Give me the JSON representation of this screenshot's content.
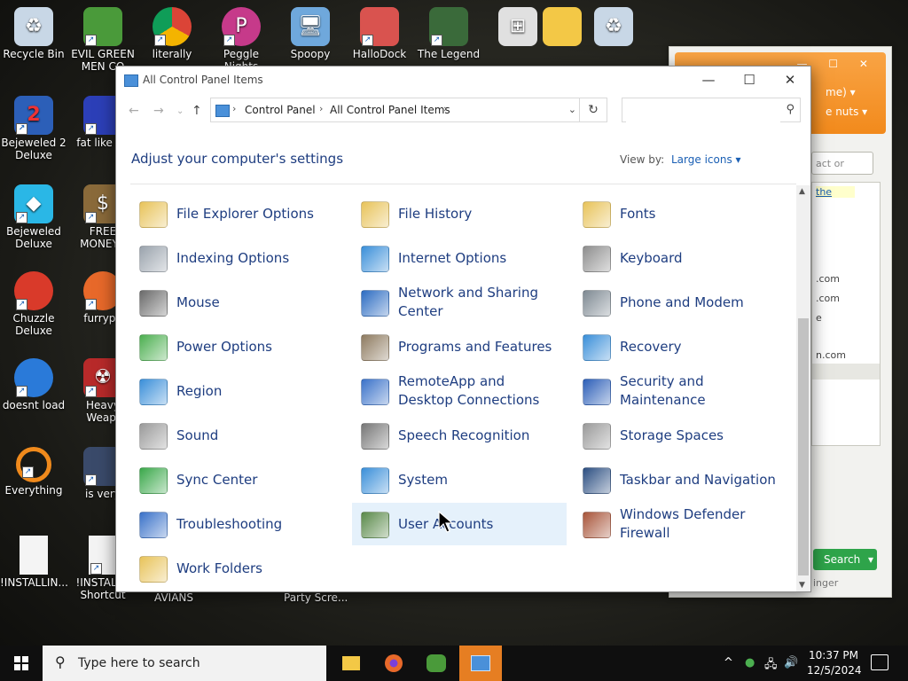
{
  "desktop": {
    "icons": [
      {
        "label": "Recycle Bin",
        "x": 0
      },
      {
        "label": "EVIL GREEN MEN CO"
      },
      {
        "label": "literally"
      },
      {
        "label": "Peggle Nights"
      },
      {
        "label": "Spoopy"
      },
      {
        "label": "HalloDock"
      },
      {
        "label": "The Legend"
      },
      {
        "label": "Bejeweled 2 Deluxe"
      },
      {
        "label": "fat like da"
      },
      {
        "label": "Bejeweled Deluxe"
      },
      {
        "label": "FREE MONEY.c"
      },
      {
        "label": "Chuzzle Deluxe"
      },
      {
        "label": "furrypo"
      },
      {
        "label": "doesnt load"
      },
      {
        "label": "Heavy Weap."
      },
      {
        "label": "Everything"
      },
      {
        "label": "is very"
      },
      {
        "label": "!INSTALLIN..."
      },
      {
        "label": "!INSTALL - Shortcut"
      },
      {
        "label": "AVIANS"
      },
      {
        "label": "Party Scre..."
      }
    ]
  },
  "bg_window": {
    "line1": "me) ▾",
    "line2": "e nuts ▾",
    "input_placeholder": "act or numbe",
    "link": "the",
    "rows": [
      ".com",
      ".com",
      "e",
      "n.com"
    ],
    "search_btn": "Search",
    "footer": "inger"
  },
  "window": {
    "title": "All Control Panel Items",
    "minimize": "—",
    "maximize": "☐",
    "close": "✕",
    "breadcrumb": [
      "Control Panel",
      "All Control Panel Items"
    ],
    "search_placeholder": "",
    "heading": "Adjust your computer's settings",
    "view_by_label": "View by:",
    "view_by_value": "Large icons ▾"
  },
  "items": [
    {
      "label": "File Explorer Options",
      "icon": "folder-options-icon",
      "color": "#e8c35a"
    },
    {
      "label": "File History",
      "icon": "file-history-icon",
      "color": "#e8c35a"
    },
    {
      "label": "Fonts",
      "icon": "fonts-icon",
      "color": "#e8c35a"
    },
    {
      "label": "Indexing Options",
      "icon": "indexing-icon",
      "color": "#9aa3ad"
    },
    {
      "label": "Internet Options",
      "icon": "internet-options-icon",
      "color": "#3a8fd9"
    },
    {
      "label": "Keyboard",
      "icon": "keyboard-icon",
      "color": "#8e8e8e"
    },
    {
      "label": "Mouse",
      "icon": "mouse-icon",
      "color": "#6a6a6a"
    },
    {
      "label": "Network and Sharing Center",
      "icon": "network-icon",
      "color": "#2c6cc2"
    },
    {
      "label": "Phone and Modem",
      "icon": "phone-modem-icon",
      "color": "#7f8a93"
    },
    {
      "label": "Power Options",
      "icon": "power-options-icon",
      "color": "#4caf50"
    },
    {
      "label": "Programs and Features",
      "icon": "programs-icon",
      "color": "#8e7b60"
    },
    {
      "label": "Recovery",
      "icon": "recovery-icon",
      "color": "#3a8fd9"
    },
    {
      "label": "Region",
      "icon": "region-icon",
      "color": "#3a8fd9"
    },
    {
      "label": "RemoteApp and Desktop Connections",
      "icon": "remoteapp-icon",
      "color": "#3a72c9"
    },
    {
      "label": "Security and Maintenance",
      "icon": "security-flag-icon",
      "color": "#2c5fb8"
    },
    {
      "label": "Sound",
      "icon": "sound-icon",
      "color": "#9a9a9a"
    },
    {
      "label": "Speech Recognition",
      "icon": "microphone-icon",
      "color": "#777777"
    },
    {
      "label": "Storage Spaces",
      "icon": "storage-icon",
      "color": "#9a9a9a"
    },
    {
      "label": "Sync Center",
      "icon": "sync-icon",
      "color": "#3aa84a"
    },
    {
      "label": "System",
      "icon": "system-icon",
      "color": "#3a8fd9"
    },
    {
      "label": "Taskbar and Navigation",
      "icon": "taskbar-icon",
      "color": "#2c4f82"
    },
    {
      "label": "Troubleshooting",
      "icon": "troubleshooting-icon",
      "color": "#3a72c9"
    },
    {
      "label": "User Accounts",
      "icon": "user-accounts-icon",
      "color": "#5a8a4a"
    },
    {
      "label": "Windows Defender Firewall",
      "icon": "firewall-icon",
      "color": "#a8553a"
    },
    {
      "label": "Work Folders",
      "icon": "work-folders-icon",
      "color": "#e8c35a"
    }
  ],
  "taskbar": {
    "search_placeholder": "Type here to search",
    "time": "10:37 PM",
    "date": "12/5/2024"
  }
}
